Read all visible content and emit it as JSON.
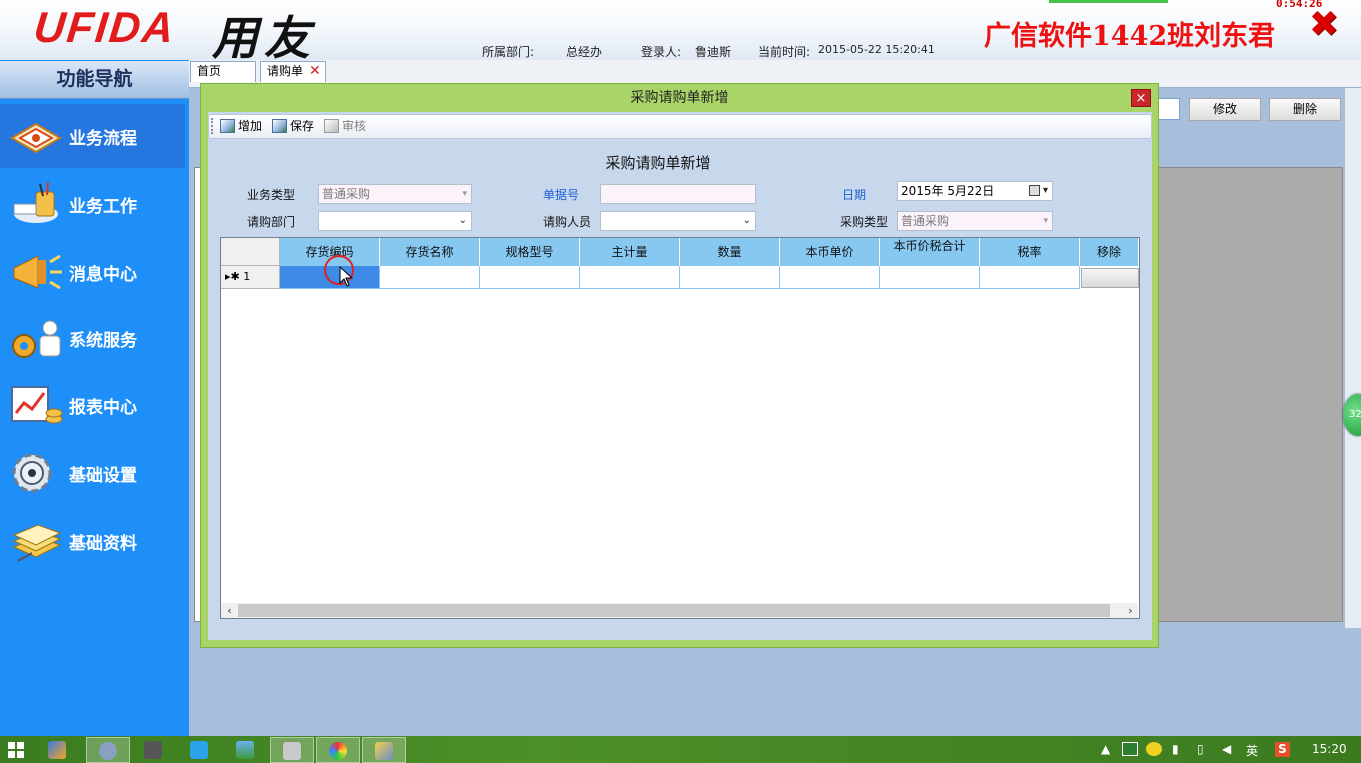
{
  "header": {
    "logo_en": "UFIDA",
    "logo_cn": "用友",
    "dept_label": "所属部门:",
    "dept_value": "总经办",
    "user_label": "登录人:",
    "user_value": "鲁迪斯",
    "time_label": "当前时间:",
    "time_value": "2015-05-22 15:20:41",
    "banner": "广信软件1442班刘东君",
    "clock": "0:54:26"
  },
  "sidebar": {
    "title": "功能导航",
    "items": [
      {
        "label": "业务流程",
        "icon": "workflow-icon",
        "active": true
      },
      {
        "label": "业务工作",
        "icon": "pen-cup-icon",
        "active": false
      },
      {
        "label": "消息中心",
        "icon": "megaphone-icon",
        "active": false
      },
      {
        "label": "系统服务",
        "icon": "service-gear-icon",
        "active": false
      },
      {
        "label": "报表中心",
        "icon": "report-chart-icon",
        "active": false
      },
      {
        "label": "基础设置",
        "icon": "settings-gear-icon",
        "active": false
      },
      {
        "label": "基础资料",
        "icon": "books-icon",
        "active": false
      }
    ]
  },
  "tabs": [
    {
      "label": "首页"
    },
    {
      "label": "请购单",
      "close": "✕"
    }
  ],
  "background_buttons": {
    "modify": "修改",
    "delete": "删除"
  },
  "dialog": {
    "title": "采购请购单新增",
    "close": "×",
    "toolbar": [
      {
        "label": "增加",
        "enabled": true
      },
      {
        "label": "保存",
        "enabled": true
      },
      {
        "label": "审核",
        "enabled": false
      }
    ],
    "form_title": "采购请购单新增",
    "fields": {
      "biz_type": {
        "label": "业务类型",
        "value": "普通采购"
      },
      "doc_no": {
        "label": "单据号",
        "value": ""
      },
      "date": {
        "label": "日期",
        "value": "2015年 5月22日"
      },
      "dept": {
        "label": "请购部门",
        "value": ""
      },
      "requester": {
        "label": "请购人员",
        "value": ""
      },
      "purchase_type": {
        "label": "采购类型",
        "value": "普通采购"
      }
    },
    "grid": {
      "columns": [
        "存货编码",
        "存货名称",
        "规格型号",
        "主计量",
        "数量",
        "本币单价",
        "本币价税合计",
        "税率",
        "移除"
      ],
      "row_marker": "▸✱",
      "row_number": "1"
    }
  },
  "float_badge": "32",
  "taskbar": {
    "tray_lang": "英",
    "tray_ime": "S",
    "time": "15:20"
  }
}
